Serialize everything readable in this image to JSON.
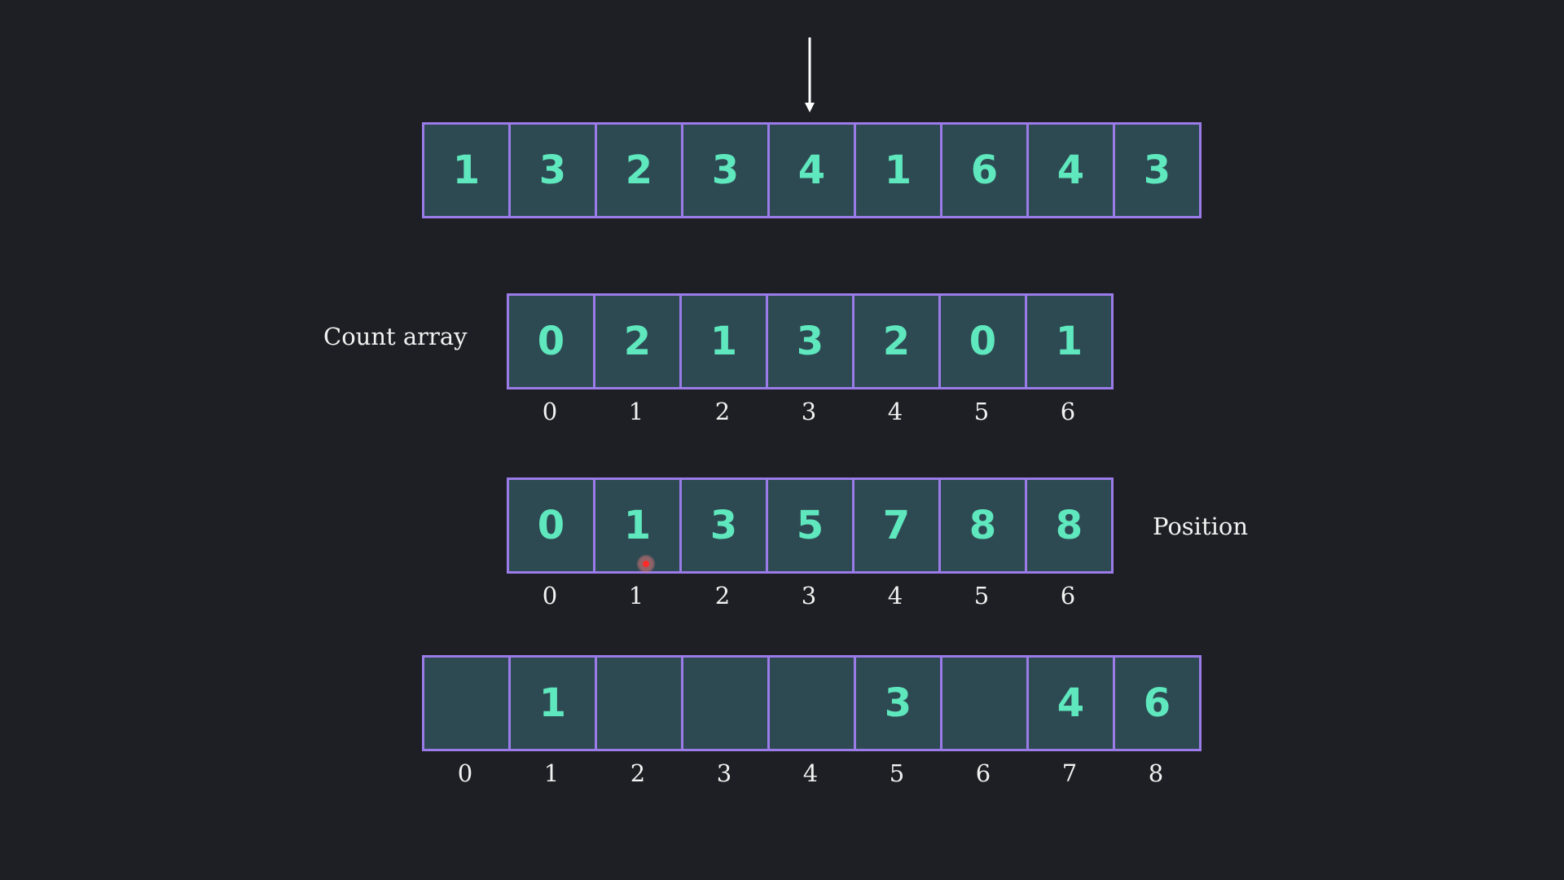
{
  "input_array": {
    "values": [
      "1",
      "3",
      "2",
      "3",
      "4",
      "1",
      "6",
      "4",
      "3"
    ],
    "pointer_index": 4
  },
  "count_array": {
    "label": "Count array",
    "values": [
      "0",
      "2",
      "1",
      "3",
      "2",
      "0",
      "1"
    ],
    "indices": [
      "0",
      "1",
      "2",
      "3",
      "4",
      "5",
      "6"
    ]
  },
  "position_array": {
    "label": "Position",
    "values": [
      "0",
      "1",
      "3",
      "5",
      "7",
      "8",
      "8"
    ],
    "indices": [
      "0",
      "1",
      "2",
      "3",
      "4",
      "5",
      "6"
    ]
  },
  "output_array": {
    "values": [
      "",
      "1",
      "",
      "",
      "",
      "3",
      "",
      "4",
      "6"
    ],
    "indices": [
      "0",
      "1",
      "2",
      "3",
      "4",
      "5",
      "6",
      "7",
      "8"
    ]
  },
  "colors": {
    "background": "#1e1f24",
    "cell_fill": "#2d4a53",
    "cell_border": "#9a7be8",
    "value_text": "#5fe8bd",
    "label_text": "#f2f2f2",
    "cursor": "#ff2a2a"
  }
}
